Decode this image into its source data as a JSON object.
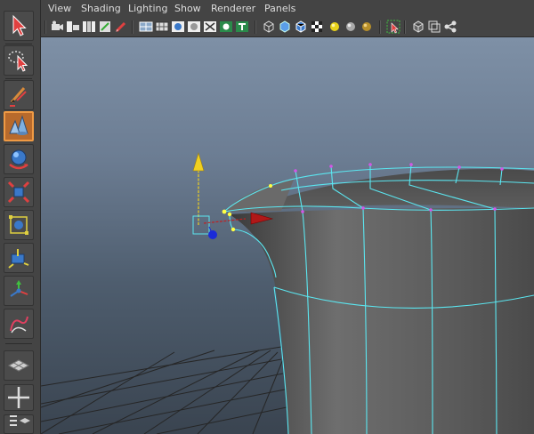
{
  "menu": {
    "view": "View",
    "shading": "Shading",
    "lighting": "Lighting",
    "show": "Show",
    "renderer": "Renderer",
    "panels": "Panels"
  },
  "toolbox": {
    "tools": [
      "select-tool",
      "lasso-tool",
      "paint-select-tool",
      "soft-select-tool",
      "rotate-tool",
      "scale-tool",
      "universal-manipulator",
      "show-manipulator",
      "move-tool",
      "curve-tool"
    ],
    "active": "soft-select-tool"
  },
  "colors": {
    "ui_bg": "#444444",
    "active_tool": "#b86a2c",
    "viewport_top": "#7e90a6",
    "viewport_bottom": "#3a4450",
    "wireframe": "#5be6f0",
    "vertex_selected": "#ffff44",
    "vertex": "#d455e6",
    "manip_y": "#f0d020",
    "manip_x": "#c02020",
    "manip_z": "#1a2ad8"
  }
}
